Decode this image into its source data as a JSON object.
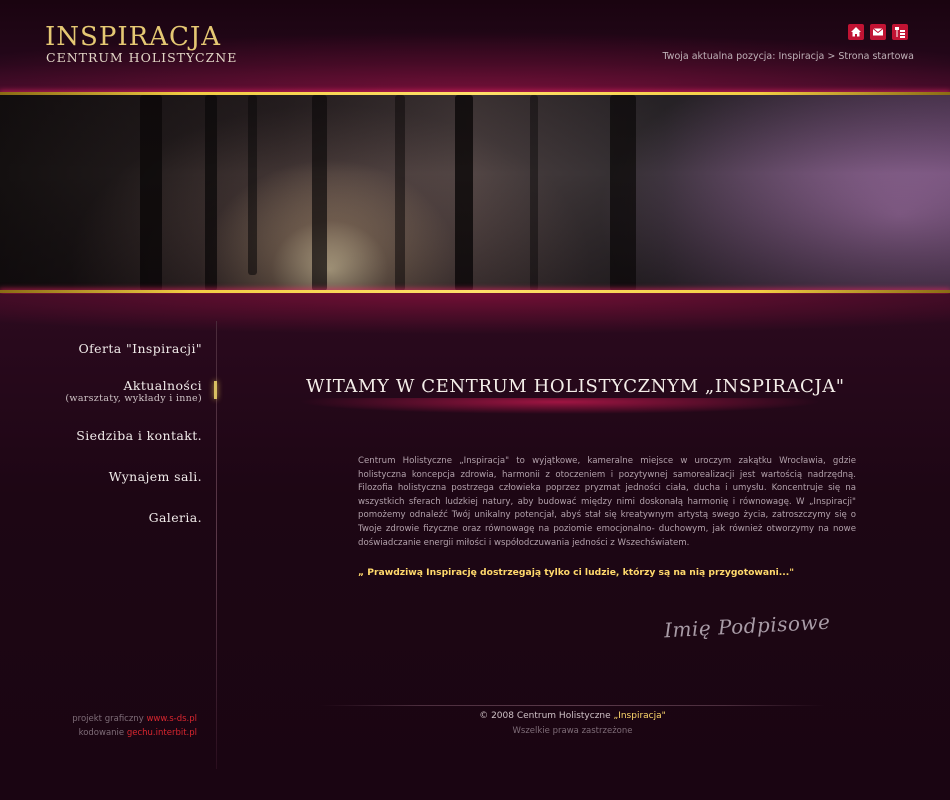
{
  "header": {
    "title": "INSPIRACJA",
    "subtitle": "CENTRUM HOLISTYCZNE",
    "breadcrumb": "Twoja aktualna pozycja: Inspiracja > Strona startowa",
    "icons": [
      "home-icon",
      "mail-icon",
      "sitemap-icon"
    ]
  },
  "menu": {
    "items": [
      {
        "label": "Oferta \"Inspiracji\""
      },
      {
        "label": "Aktualności",
        "sub": "(warsztaty, wykłady i inne)"
      },
      {
        "label": "Siedziba i kontakt."
      },
      {
        "label": "Wynajem sali."
      },
      {
        "label": "Galeria."
      }
    ],
    "active_index": 1
  },
  "main": {
    "heading": "WITAMY W CENTRUM HOLISTYCZNYM „INSPIRACJA\"",
    "paragraph": "Centrum Holistyczne „Inspiracja\" to wyjątkowe, kameralne miejsce w uroczym zakątku Wrocławia, gdzie holistyczna koncepcja zdrowia, harmonii z otoczeniem i pozytywnej samorealizacji jest wartością nadrzędną. Filozofia holistyczna postrzega człowieka poprzez pryzmat jedności ciała, ducha i umysłu. Koncentruje się na wszystkich sferach ludzkiej natury, aby budować między nimi doskonałą harmonię i równowagę. W „Inspiracji\" pomożemy odnaleźć Twój unikalny potencjał, abyś stał się kreatywnym artystą swego życia, zatroszczymy się o Twoje zdrowie fizyczne oraz równowagę na poziomie emocjonalno- duchowym, jak również otworzymy na nowe doświadczanie energii miłości i współodczuwania jedności z Wszechświatem.",
    "quote": "„ Prawdziwą Inspirację dostrzegają tylko ci ludzie, którzy są na nią przygotowani...\"",
    "signature": "Imię Podpisowe"
  },
  "footer": {
    "copyright_prefix": "© 2008 Centrum Holistyczne ",
    "copyright_name": "„Inspiracja\"",
    "rights": "Wszelkie prawa zastrzeżone",
    "credit1_label": "projekt graficzny",
    "credit1_link": "www.s-ds.pl",
    "credit2_label": "kodowanie",
    "credit2_link": "gechu.interbit.pl"
  },
  "colors": {
    "background": "#1c0612",
    "accent_gold": "#e5c873",
    "accent_red": "#c11333",
    "glow_magenta": "#c8195a"
  }
}
